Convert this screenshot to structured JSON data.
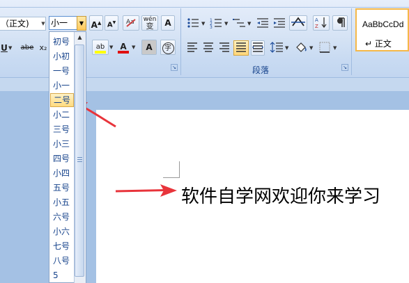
{
  "ribbon": {
    "font_name": "（正文)",
    "font_size": "小一",
    "font_buttons": {
      "grow": "A",
      "shrink": "A",
      "clear_format": "A",
      "phonetic": "wén",
      "phonetic_char": "变",
      "char_border": "A",
      "underline": "U",
      "strikethrough": "abe",
      "subscript": "x₂",
      "highlight": "ab",
      "font_color": "A",
      "char_shading": "A",
      "enclose": "字"
    },
    "paragraph_label": "段落",
    "style_sample": "AaBbCcDd",
    "style_name": "↵ 正文"
  },
  "font_size_list": [
    "初号",
    "小初",
    "一号",
    "小一",
    "二号",
    "小二",
    "三号",
    "小三",
    "四号",
    "小四",
    "五号",
    "小五",
    "六号",
    "小六",
    "七号",
    "八号",
    "5"
  ],
  "highlighted_item": "二号",
  "document": {
    "text": "软件自学网欢迎你来学习"
  },
  "colors": {
    "accent": "#15428b",
    "arrow": "#e8343b",
    "hover": "#ffdb80"
  }
}
